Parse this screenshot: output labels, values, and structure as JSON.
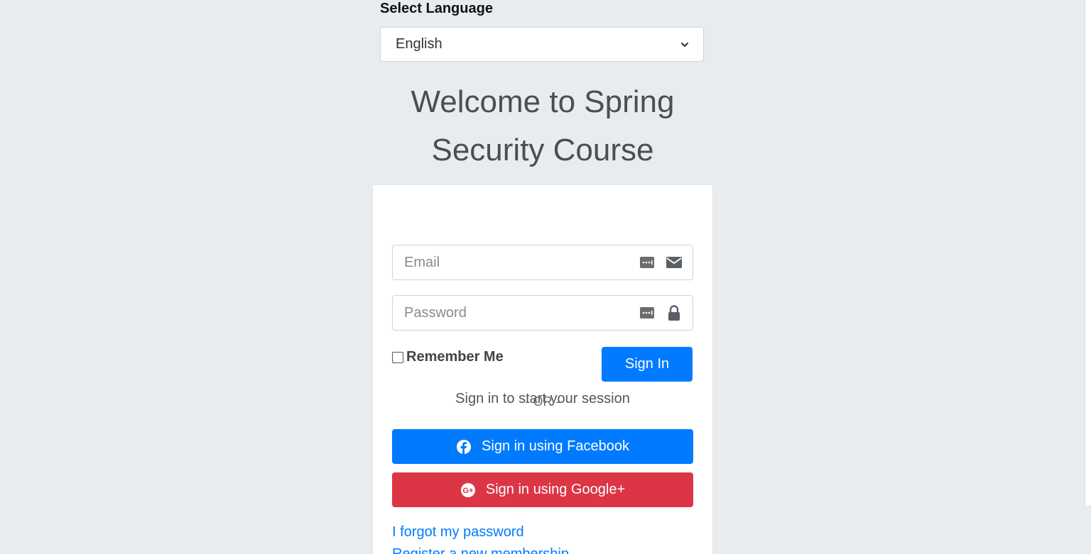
{
  "language": {
    "label": "Select Language",
    "selected": "English"
  },
  "title": {
    "line1": "Welcome to Spring",
    "line2": "Security Course"
  },
  "login": {
    "message": "Sign in to start your session",
    "email_placeholder": "Email",
    "password_placeholder": "Password",
    "remember_label": "Remember Me",
    "signin_label": "Sign In",
    "or_label": "- OR -",
    "facebook_label": "Sign in using Facebook",
    "google_label": "Sign in using Google+",
    "forgot_label": "I forgot my password",
    "register_label": "Register a new membership"
  },
  "icons": {
    "email": "envelope-icon",
    "password": "lock-icon",
    "autofill": "password-manager-icon",
    "facebook": "facebook-icon",
    "google": "google-plus-icon",
    "select": "chevron-down-icon"
  },
  "colors": {
    "primary": "#007bff",
    "danger": "#dc3545",
    "background": "#e9ecef"
  }
}
